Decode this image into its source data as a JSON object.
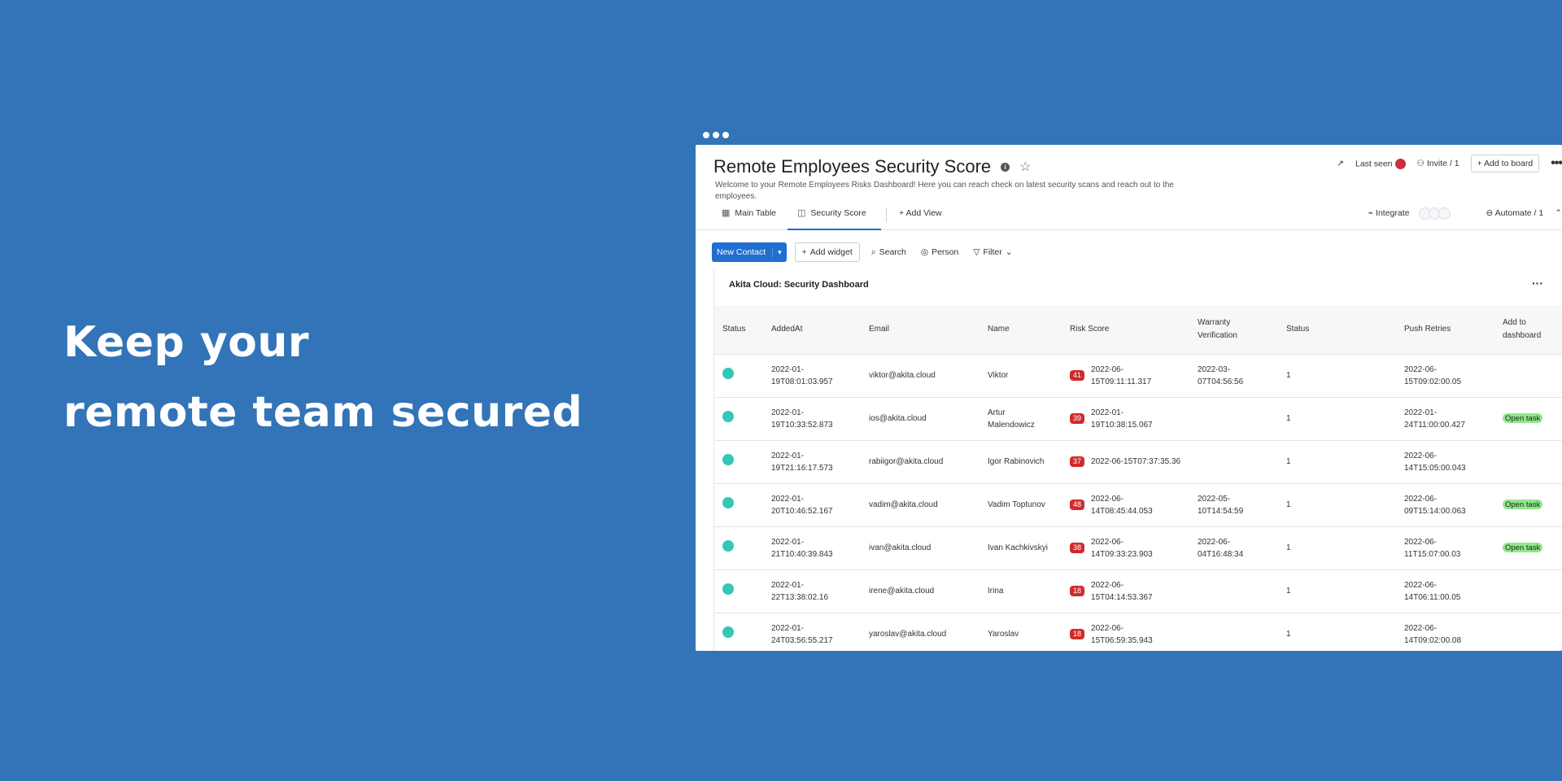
{
  "hero": {
    "line1": "Keep your",
    "line2": "remote team secured"
  },
  "board": {
    "title": "Remote Employees Security Score",
    "description": "Welcome to your Remote Employees Risks Dashboard! Here you can reach check on latest security scans and reach out to the employees.",
    "last_seen": "Last seen",
    "invite": "Invite / 1",
    "add_to_board": "+ Add to board"
  },
  "tabs": {
    "main_table": "Main Table",
    "security_score": "Security Score",
    "add_view": "+ Add View",
    "integrate": "Integrate",
    "automate": "Automate / 1"
  },
  "toolbar": {
    "new_contact": "New Contact",
    "add_widget": "Add widget",
    "search": "Search",
    "person": "Person",
    "filter": "Filter"
  },
  "widget": {
    "title": "Akita Cloud: Security Dashboard"
  },
  "table": {
    "headers": [
      "Status",
      "AddedAt",
      "Email",
      "Name",
      "Risk Score",
      "Warranty Verification",
      "Status",
      "Push Retries",
      "Add to dashboard"
    ],
    "rows": [
      {
        "added": "2022-01-19T08:01:03.957",
        "email": "viktor@akita.cloud",
        "name": "Viktor",
        "score": "41",
        "risk_date": "2022-06-15T09:11:11.317",
        "warranty": "2022-03-07T04:56:56",
        "status": "1",
        "push": "2022-06-15T09:02:00.05",
        "action": ""
      },
      {
        "added": "2022-01-19T10:33:52.873",
        "email": "ios@akita.cloud",
        "name": "Artur Malendowicz",
        "score": "39",
        "risk_date": "2022-01-19T10:38:15.067",
        "warranty": "",
        "status": "1",
        "push": "2022-01-24T11:00:00.427",
        "action": "Open task"
      },
      {
        "added": "2022-01-19T21:16:17.573",
        "email": "rabiigor@akita.cloud",
        "name": "Igor Rabinovich",
        "score": "37",
        "risk_date": "2022-06-15T07:37:35.36",
        "warranty": "",
        "status": "1",
        "push": "2022-06-14T15:05:00.043",
        "action": ""
      },
      {
        "added": "2022-01-20T10:46:52.167",
        "email": "vadim@akita.cloud",
        "name": "Vadim Toptunov",
        "score": "48",
        "risk_date": "2022-06-14T08:45:44.053",
        "warranty": "2022-05-10T14:54:59",
        "status": "1",
        "push": "2022-06-09T15:14:00.063",
        "action": "Open task"
      },
      {
        "added": "2022-01-21T10:40:39.843",
        "email": "ivan@akita.cloud",
        "name": "Ivan Kachkivskyi",
        "score": "38",
        "risk_date": "2022-06-14T09:33:23.903",
        "warranty": "2022-06-04T16:48:34",
        "status": "1",
        "push": "2022-06-11T15:07:00.03",
        "action": "Open task"
      },
      {
        "added": "2022-01-22T13:38:02.16",
        "email": "irene@akita.cloud",
        "name": "Irina",
        "score": "18",
        "risk_date": "2022-06-15T04:14:53.367",
        "warranty": "",
        "status": "1",
        "push": "2022-06-14T06:11:00.05",
        "action": ""
      },
      {
        "added": "2022-01-24T03:56:55.217",
        "email": "yaroslav@akita.cloud",
        "name": "Yaroslav",
        "score": "18",
        "risk_date": "2022-06-15T06:59:35.943",
        "warranty": "",
        "status": "1",
        "push": "2022-06-14T09:02:00.08",
        "action": ""
      }
    ]
  },
  "colors": {
    "background": "#3274b7",
    "primary": "#1f6fd0",
    "status_dot": "#33c7b8",
    "risk_badge": "#d02b2b",
    "open_task": "#8fe88a"
  }
}
